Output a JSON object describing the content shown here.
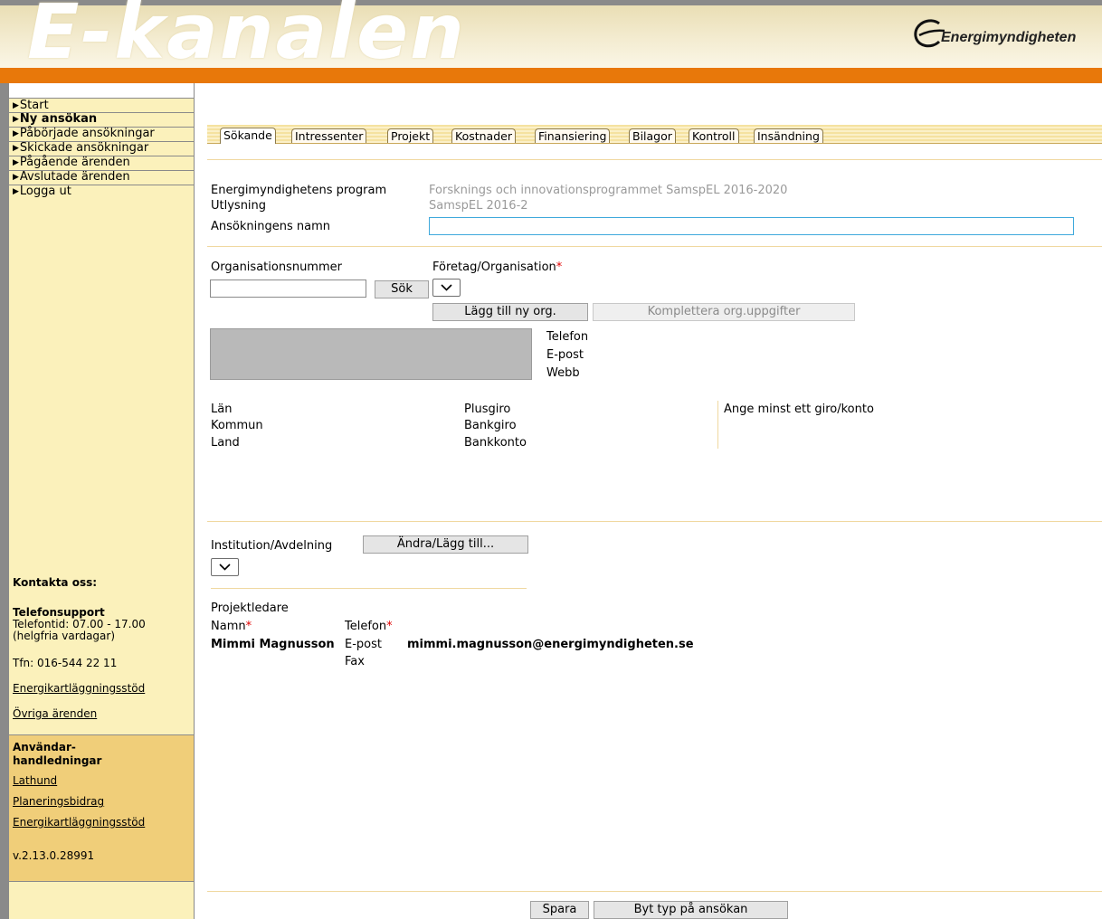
{
  "header": {
    "banner": "E-kanalen",
    "logo_text": "Energimyndigheten"
  },
  "nav": {
    "items": [
      {
        "label": "Start",
        "bold": false
      },
      {
        "label": "Ny ansökan",
        "bold": true
      },
      {
        "label": "Påbörjade ansökningar",
        "bold": false
      },
      {
        "label": "Skickade ansökningar",
        "bold": false
      },
      {
        "label": "Pågående ärenden",
        "bold": false
      },
      {
        "label": "Avslutade ärenden",
        "bold": false
      },
      {
        "label": "Logga ut",
        "bold": false
      }
    ]
  },
  "contact": {
    "title": "Kontakta oss:",
    "phone_title": "Telefonsupport",
    "hours_line1": "Telefontid: 07.00 - 17.00",
    "hours_line2": "(helgfria vardagar)",
    "tfn": "Tfn: 016-544 22 11",
    "link1": "Energikartläggningsstöd",
    "link2": "Övriga ärenden"
  },
  "guides": {
    "title_line1": "Användar-",
    "title_line2": "handledningar",
    "links": [
      "Lathund",
      "Planeringsbidrag",
      "Energikartläggningsstöd"
    ],
    "version": "v.2.13.0.28991"
  },
  "tabs": [
    "Sökande",
    "Intressenter",
    "Projekt",
    "Kostnader",
    "Finansiering",
    "Bilagor",
    "Kontroll",
    "Insändning"
  ],
  "active_tab": "Sökande",
  "program": {
    "program_label": "Energimyndighetens program",
    "program_value": "Forsknings och innovationsprogrammet SamspEL 2016-2020",
    "call_label": "Utlysning",
    "call_value": "SamspEL 2016-2",
    "name_label": "Ansökningens namn",
    "name_value": ""
  },
  "org": {
    "orgnr_label": "Organisationsnummer",
    "orgnr_value": "",
    "search_button": "Sök",
    "company_label": "Företag/Organisation",
    "required_mark": "*",
    "add_org_button": "Lägg till ny org.",
    "complete_org_button": "Komplettera org.uppgifter",
    "phone_label": "Telefon",
    "email_label": "E-post",
    "web_label": "Webb",
    "county_label": "Län",
    "municipality_label": "Kommun",
    "country_label": "Land",
    "plusgiro_label": "Plusgiro",
    "bankgiro_label": "Bankgiro",
    "bankkonto_label": "Bankkonto",
    "giro_hint": "Ange minst ett giro/konto"
  },
  "institution": {
    "label": "Institution/Avdelning",
    "change_button": "Ändra/Lägg till..."
  },
  "project_leader": {
    "title": "Projektledare",
    "name_label": "Namn",
    "phone_label": "Telefon",
    "name_value": "Mimmi Magnusson",
    "email_label": "E-post",
    "email_value": "mimmi.magnusson@energimyndigheten.se",
    "fax_label": "Fax"
  },
  "footer": {
    "save_button": "Spara",
    "change_type_button": "Byt typ på ansökan"
  },
  "colors": {
    "orange": "#e8780a",
    "sidebar_bg": "#fbf1bb",
    "guides_bg": "#f0ce79",
    "required": "#e00000"
  }
}
